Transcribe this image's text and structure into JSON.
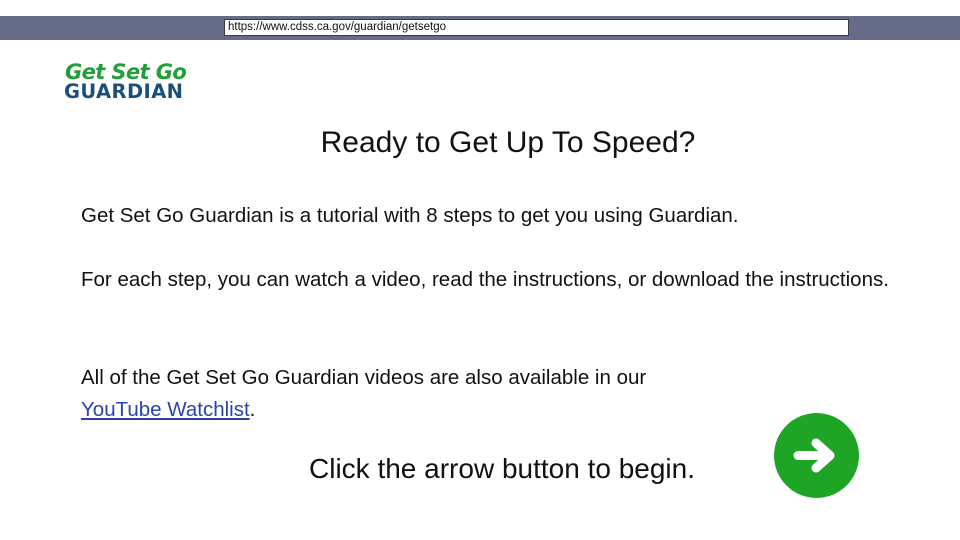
{
  "browser": {
    "url": "https://www.cdss.ca.gov/guardian/getsetgo"
  },
  "logo": {
    "line1": "Get Set Go",
    "line2": "GUARDIAN"
  },
  "page": {
    "title": "Ready to Get Up To Speed?",
    "para1": "Get Set Go Guardian is a tutorial with 8 steps to get you using Guardian.",
    "para2": "For each step, you can watch a video, read the instructions, or download the instructions.",
    "para3_text": "All of the Get Set Go Guardian videos are also available in our",
    "link_text": "YouTube Watchlist",
    "para3_end": ".",
    "cta": "Click the arrow button to begin."
  },
  "arrow_button": {
    "icon": "arrow-right-icon",
    "color": "#1ea526"
  },
  "colors": {
    "top_bar": "#676b8a",
    "logo_green": "#21a038",
    "logo_blue": "#1b4f7a",
    "link": "#2a44a8"
  }
}
